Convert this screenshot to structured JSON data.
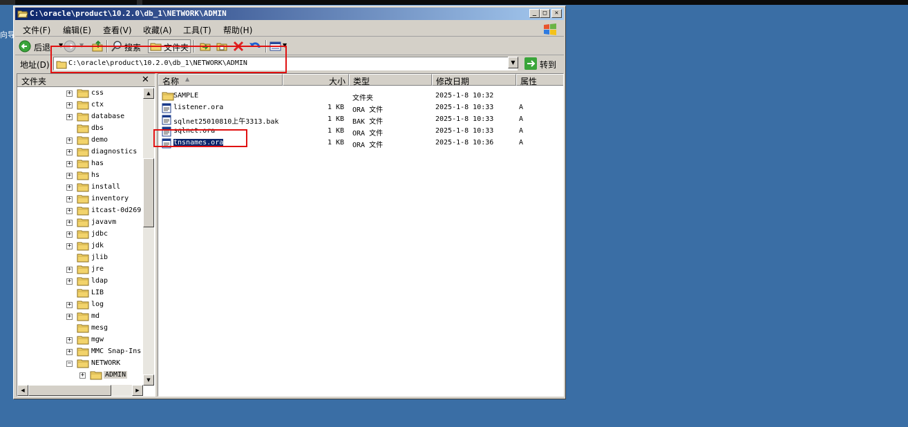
{
  "desktop": {
    "side_text": "向导"
  },
  "window": {
    "title": "C:\\oracle\\product\\10.2.0\\db_1\\NETWORK\\ADMIN",
    "minimize": "_",
    "maximize": "□",
    "close": "✕"
  },
  "menu": [
    {
      "label": "文件(F)"
    },
    {
      "label": "编辑(E)"
    },
    {
      "label": "查看(V)"
    },
    {
      "label": "收藏(A)"
    },
    {
      "label": "工具(T)"
    },
    {
      "label": "帮助(H)"
    }
  ],
  "toolbar": {
    "back": "后退",
    "search": "搜索",
    "folders": "文件夹"
  },
  "address": {
    "label": "地址(D)",
    "value": "C:\\oracle\\product\\10.2.0\\db_1\\NETWORK\\ADMIN",
    "go": "转到"
  },
  "folders_pane": {
    "title": "文件夹",
    "close": "✕"
  },
  "tree": [
    {
      "name": "css",
      "expand": "+"
    },
    {
      "name": "ctx",
      "expand": "+"
    },
    {
      "name": "database",
      "expand": "+"
    },
    {
      "name": "dbs",
      "expand": ""
    },
    {
      "name": "demo",
      "expand": "+"
    },
    {
      "name": "diagnostics",
      "expand": "+"
    },
    {
      "name": "has",
      "expand": "+"
    },
    {
      "name": "hs",
      "expand": "+"
    },
    {
      "name": "install",
      "expand": "+"
    },
    {
      "name": "inventory",
      "expand": "+"
    },
    {
      "name": "itcast-0d269",
      "expand": "+"
    },
    {
      "name": "javavm",
      "expand": "+"
    },
    {
      "name": "jdbc",
      "expand": "+"
    },
    {
      "name": "jdk",
      "expand": "+"
    },
    {
      "name": "jlib",
      "expand": ""
    },
    {
      "name": "jre",
      "expand": "+"
    },
    {
      "name": "ldap",
      "expand": "+"
    },
    {
      "name": "LIB",
      "expand": ""
    },
    {
      "name": "log",
      "expand": "+"
    },
    {
      "name": "md",
      "expand": "+"
    },
    {
      "name": "mesg",
      "expand": ""
    },
    {
      "name": "mgw",
      "expand": "+"
    },
    {
      "name": "MMC Snap-Ins",
      "expand": "+"
    },
    {
      "name": "NETWORK",
      "expand": "−"
    },
    {
      "name": "ADMIN",
      "expand": "+"
    }
  ],
  "columns": {
    "name": "名称",
    "size": "大小",
    "type": "类型",
    "modified": "修改日期",
    "attr": "属性"
  },
  "files": [
    {
      "name": "SAMPLE",
      "size": "",
      "type": "文件夹",
      "modified": "2025-1-8 10:32",
      "attr": "",
      "icon": "folder-icon"
    },
    {
      "name": "listener.ora",
      "size": "1 KB",
      "type": "ORA 文件",
      "modified": "2025-1-8 10:33",
      "attr": "A",
      "icon": "file-icon"
    },
    {
      "name": "sqlnet25010810上午3313.bak",
      "size": "1 KB",
      "type": "BAK 文件",
      "modified": "2025-1-8 10:33",
      "attr": "A",
      "icon": "file-icon"
    },
    {
      "name": "sqlnet.ora",
      "size": "1 KB",
      "type": "ORA 文件",
      "modified": "2025-1-8 10:33",
      "attr": "A",
      "icon": "file-icon"
    },
    {
      "name": "tnsnames.ora",
      "size": "1 KB",
      "type": "ORA 文件",
      "modified": "2025-1-8 10:36",
      "attr": "A",
      "icon": "file-icon",
      "selected": true
    }
  ],
  "colors": {
    "desktop": "#3a6ea5",
    "selection": "#0a246a",
    "annotation": "#e01010"
  }
}
